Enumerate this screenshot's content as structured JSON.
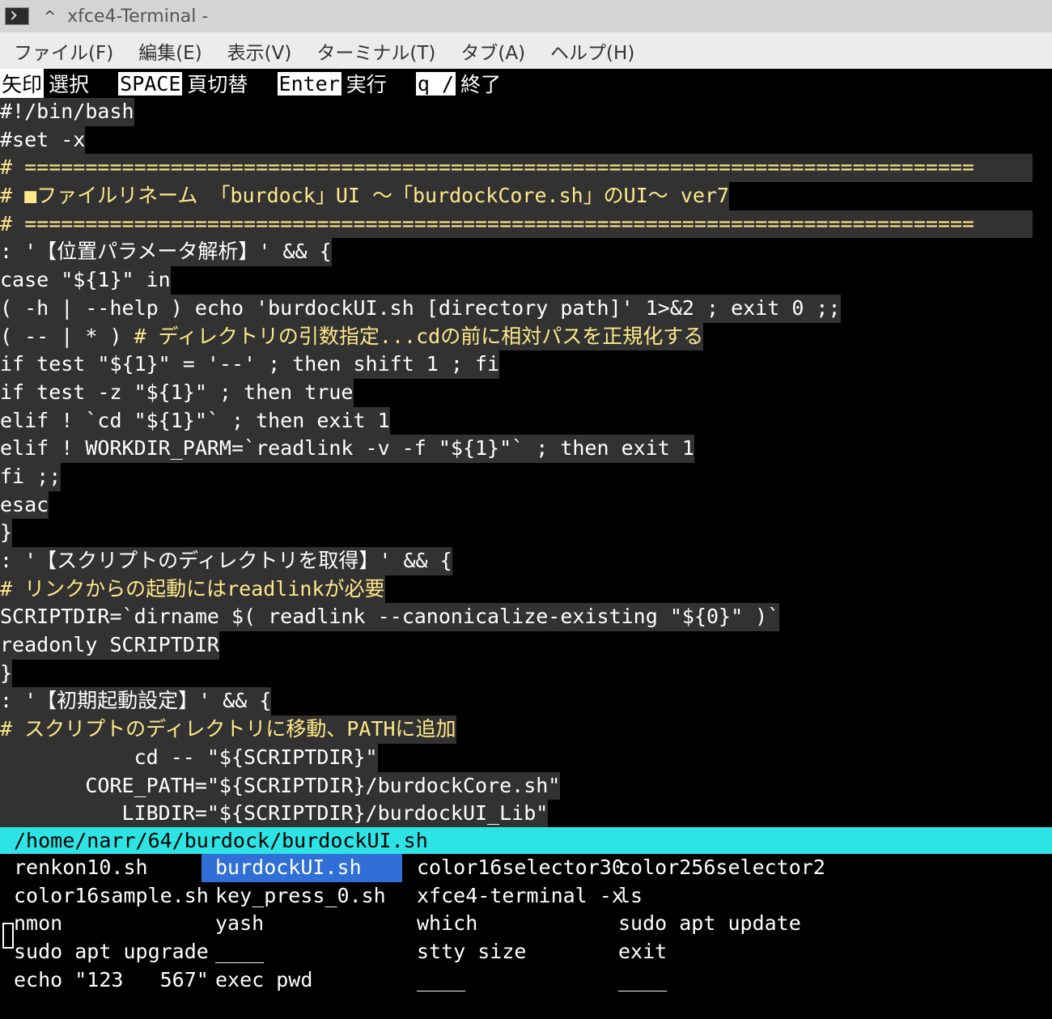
{
  "window": {
    "title": "xfce4-Terminal -",
    "icon": "terminal-icon",
    "caret": "^"
  },
  "menu": [
    "ファイル(F)",
    "編集(E)",
    "表示(V)",
    "ターミナル(T)",
    "タブ(A)",
    "ヘルプ(H)"
  ],
  "helpbar": [
    {
      "key": "矢印",
      "desc": "選択"
    },
    {
      "key": "SPACE",
      "desc": "頁切替"
    },
    {
      "key": "Enter",
      "desc": "実行"
    },
    {
      "key": "q /",
      "desc": "終了"
    }
  ],
  "code_lines": [
    {
      "text": "#!/bin/bash"
    },
    {
      "text": "#set -x"
    },
    {
      "text": "# ==============================================================================",
      "highlight": true
    },
    {
      "text": "# ■ファイルリネーム 「burdock」UI 〜「burdockCore.sh」のUI〜 ver7",
      "highlight": true
    },
    {
      "text": "# ==============================================================================",
      "highlight": true
    },
    {
      "text": ": '【位置パラメータ解析】' && {"
    },
    {
      "text": "case \"${1}\" in"
    },
    {
      "text": "( -h | --help ) echo 'burdockUI.sh [directory path]' 1>&2 ; exit 0 ;;"
    },
    {
      "text": "( -- | * ) ",
      "highlight_tail": "# ディレクトリの引数指定...cdの前に相対パスを正規化する"
    },
    {
      "text": "if test \"${1}\" = '--' ; then shift 1 ; fi"
    },
    {
      "text": "if test -z \"${1}\" ; then true"
    },
    {
      "text": "elif ! `cd \"${1}\"` ; then exit 1"
    },
    {
      "text": "elif ! WORKDIR_PARM=`readlink -v -f \"${1}\"` ; then exit 1"
    },
    {
      "text": "fi ;;"
    },
    {
      "text": "esac"
    },
    {
      "text": "}"
    },
    {
      "text": ": '【スクリプトのディレクトリを取得】' && {"
    },
    {
      "text": "# リンクからの起動にはreadlinkが必要",
      "highlight": true
    },
    {
      "text": "SCRIPTDIR=`dirname $( readlink --canonicalize-existing \"${0}\" )`"
    },
    {
      "text": "readonly SCRIPTDIR"
    },
    {
      "text": "}"
    },
    {
      "text": ": '【初期起動設定】' && {"
    },
    {
      "text": "# スクリプトのディレクトリに移動、PATHに追加",
      "highlight": true
    },
    {
      "text": "           cd -- \"${SCRIPTDIR}\""
    },
    {
      "text": "       CORE_PATH=\"${SCRIPTDIR}/burdockCore.sh\""
    },
    {
      "text": "          LIBDIR=\"${SCRIPTDIR}/burdockUI_Lib\""
    }
  ],
  "path": "/home/narr/64/burdock/burdockUI.sh",
  "history": [
    [
      "renkon10.sh",
      "burdockUI.sh",
      "color16selector30",
      "color256selector2"
    ],
    [
      "color16sample.sh",
      "key_press_0.sh",
      "xfce4-terminal -x",
      "ls"
    ],
    [
      "nmon",
      "yash",
      "which",
      "sudo apt update"
    ],
    [
      "sudo apt upgrade",
      "____",
      "stty size",
      "exit"
    ],
    [
      "echo \"123   567\"",
      "exec pwd",
      "____",
      "____"
    ]
  ],
  "selected": {
    "row": 0,
    "col": 1
  },
  "colors": {
    "code_bg": "#323232",
    "comment": "#ffe88a",
    "path_bar": "#2de3e3",
    "selection": "#2f6fd6"
  }
}
